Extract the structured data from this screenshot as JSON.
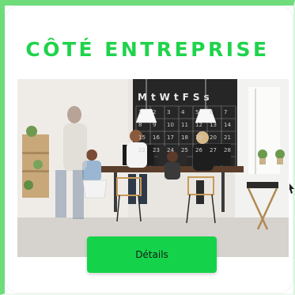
{
  "card": {
    "title": "CÔTÉ ENTREPRISE",
    "button_label": "Détails",
    "accent_color": "#14d34a",
    "border_color": "#6fdc7c"
  },
  "photo": {
    "chalkboard_letters": "MtWtFSs",
    "chalkboard_numbers": [
      "1",
      "2",
      "3",
      "4",
      "5",
      "6",
      "7",
      "8",
      "9",
      "10",
      "11",
      "12",
      "13",
      "14",
      "15",
      "16",
      "17",
      "18",
      "19",
      "20",
      "21",
      "22",
      "23",
      "24",
      "25",
      "26",
      "27",
      "28"
    ]
  }
}
